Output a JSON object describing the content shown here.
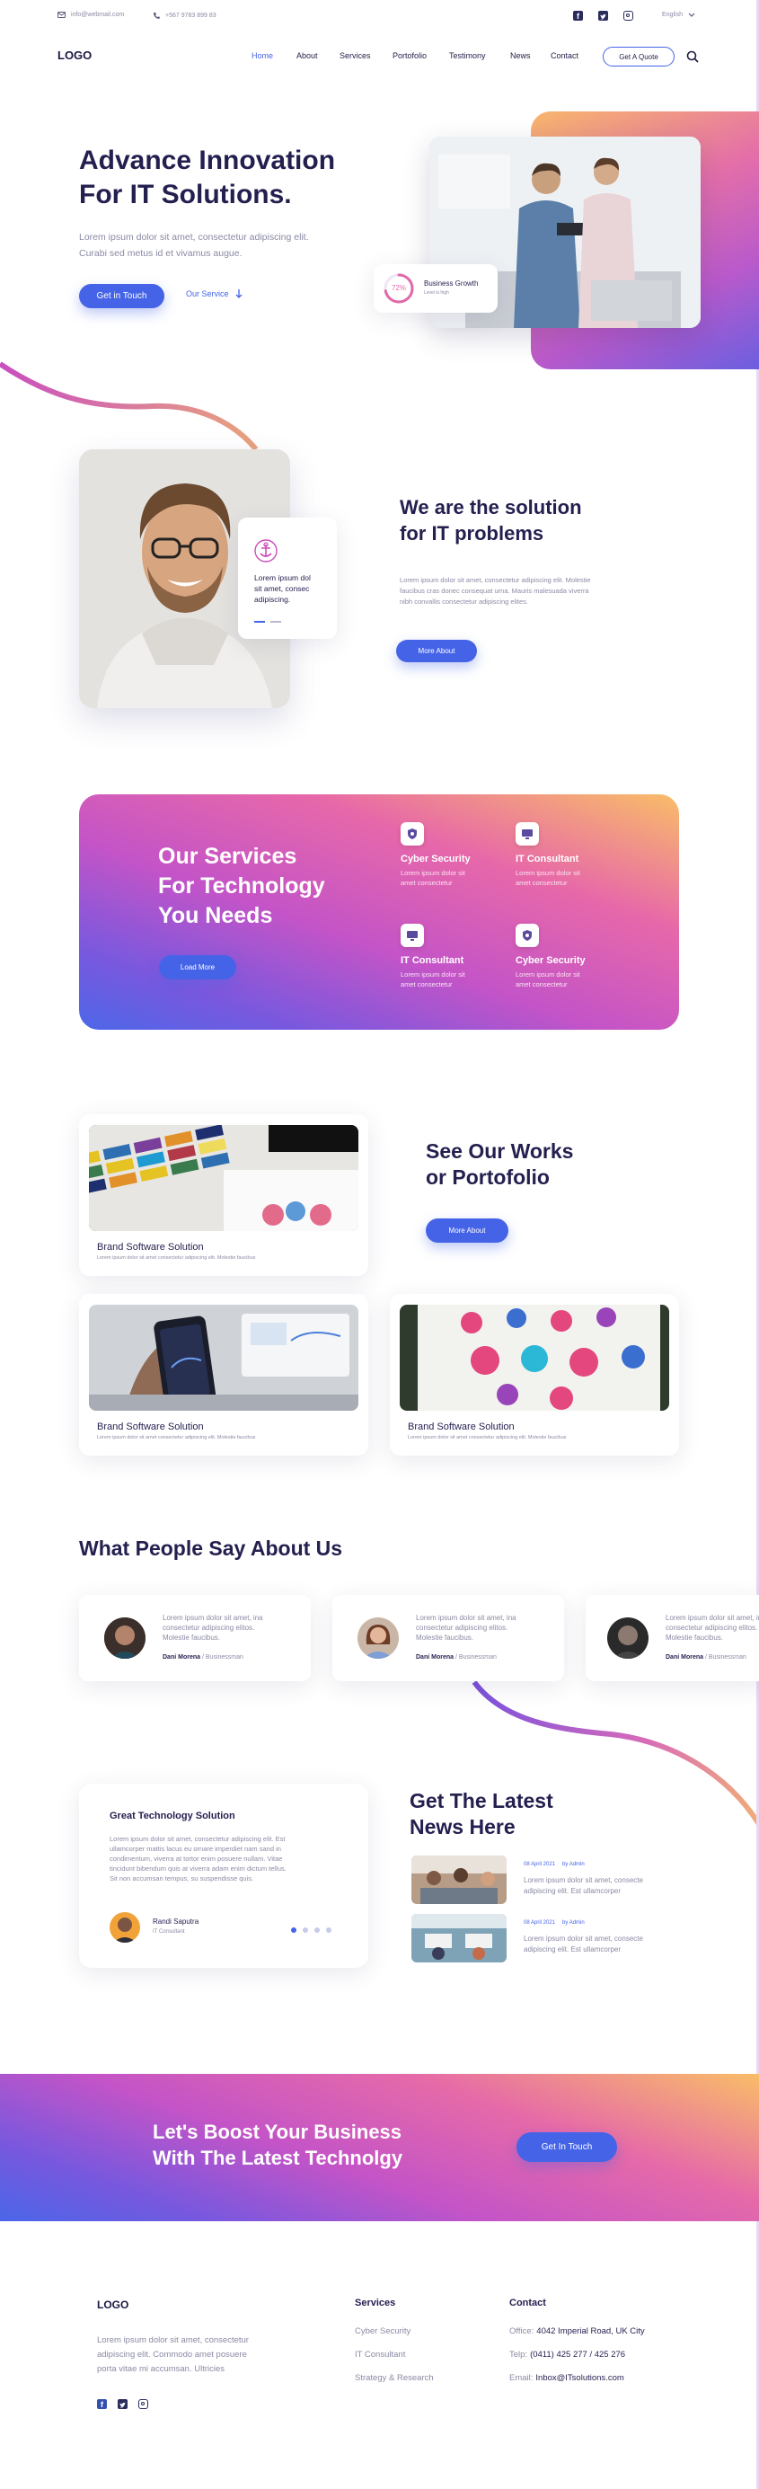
{
  "topbar": {
    "email": "info@webmail.com",
    "phone": "+567 9783 899 83",
    "language": "English"
  },
  "nav": {
    "logo": "LOGO",
    "items": [
      "Home",
      "About",
      "Services",
      "Portofolio",
      "Testimony",
      "News",
      "Contact"
    ],
    "quote_button": "Get A Quote"
  },
  "hero": {
    "title_line1": "Advance Innovation",
    "title_line2": "For IT Solutions.",
    "desc_line1": "Lorem ipsum dolor sit amet, consectetur adipiscing elit.",
    "desc_line2": "Curabi sed metus id et vivamus augue.",
    "primary_button": "Get in Touch",
    "secondary_button": "Our Service",
    "growth_percent": "72%",
    "growth_label": "Business Growth",
    "growth_sub": "Level is high",
    "growth_value": 0.72
  },
  "about": {
    "card_text_line1": "Lorem ipsum dol",
    "card_text_line2": "sit amet, consec",
    "card_text_line3": "adipiscing.",
    "title_line1": "We are the solution",
    "title_line2": "for IT problems",
    "desc_line1": "Lorem ipsum dolor sit amet, consectetur adipiscing elit. Molestie",
    "desc_line2": "faucibus cras donec consequat urna. Mauris malesuada viverra",
    "desc_line3": "nibh convallis consectetur adipiscing elites.",
    "button": "More About"
  },
  "services": {
    "title_line1": "Our Services",
    "title_line2": "For Technology",
    "title_line3": "You Needs",
    "button": "Load More",
    "items": [
      {
        "title": "Cyber Security",
        "line1": "Lorem ipsum dolor sit",
        "line2": "amet consectetur",
        "icon": "shield-icon"
      },
      {
        "title": "IT Consultant",
        "line1": "Lorem ipsum dolor sit",
        "line2": "amet consectetur",
        "icon": "monitor-icon"
      },
      {
        "title": "IT Consultant",
        "line1": "Lorem ipsum dolor sit",
        "line2": "amet consectetur",
        "icon": "monitor-icon"
      },
      {
        "title": "Cyber Security",
        "line1": "Lorem ipsum dolor sit",
        "line2": "amet consectetur",
        "icon": "shield-icon"
      }
    ]
  },
  "works": {
    "title_line1": "See Our Works",
    "title_line2": "or Portofolio",
    "button": "More About",
    "items": [
      {
        "title": "Brand Software Solution",
        "desc": "Lorem ipsum dolor sit amet consectetur adipiscing elit. Molestie faucibus"
      },
      {
        "title": "Brand Software Solution",
        "desc": "Lorem ipsum dolor sit amet consectetur adipiscing elit. Molestie faucibus"
      },
      {
        "title": "Brand Software Solution",
        "desc": "Lorem ipsum dolor sit amet consectetur adipiscing elit. Molestie faucibus"
      }
    ]
  },
  "testimonials": {
    "title": "What People Say About Us",
    "items": [
      {
        "line1": "Lorem ipsum dolor sit amet, ina",
        "line2": "consectetur adipiscing elitos.",
        "line3": "Molestie faucibus.",
        "name": "Dani Morena",
        "role": "/ Businessman"
      },
      {
        "line1": "Lorem ipsum dolor sit amet, ina",
        "line2": "consectetur adipiscing elitos.",
        "line3": "Molestie faucibus.",
        "name": "Dani Morena",
        "role": "/ Businessman"
      },
      {
        "line1": "Lorem ipsum dolor sit amet, ina",
        "line2": "consectetur adipiscing elitos.",
        "line3": "Molestie faucibus.",
        "name": "Dani Morena",
        "role": "/ Businessman"
      }
    ]
  },
  "feature": {
    "title": "Great Technology Solution",
    "lines": [
      "Lorem ipsum dolor sit amet, consectetur adipiscing elit. Est",
      "ullamcorper mattis lacus eu ornare imperdiet nam sand in",
      "condimentum, viverra at tortor enim posuere nullam. Vitae",
      "tincidunt bibendum quis at viverra adam enim dictum tellus.",
      "Sit non accumsan tempus, su suspendisse quis."
    ],
    "author_name": "Randi Saputra",
    "author_role": "IT Consultant"
  },
  "news": {
    "title_line1": "Get The Latest",
    "title_line2": "News Here",
    "items": [
      {
        "date": "08 April 2021",
        "author": "by Admin",
        "line1": "Lorem ipsum dolor sit amet, consecte",
        "line2": "adipiscing elit. Est ullamcorper"
      },
      {
        "date": "08 April 2021",
        "author": "by Admin",
        "line1": "Lorem ipsum dolor sit amet, consecte",
        "line2": "adipiscing elit. Est ullamcorper"
      }
    ]
  },
  "cta": {
    "title_line1": "Let's Boost Your Business",
    "title_line2": "With The Latest Technolgy",
    "button": "Get In Touch"
  },
  "footer": {
    "logo": "LOGO",
    "desc_line1": "Lorem ipsum dolor sit amet, consectetur",
    "desc_line2": "adipiscing elit. Commodo amet posuere",
    "desc_line3": "porta vitae mi accumsan. Ultricies",
    "services_title": "Services",
    "services": [
      "Cyber Security",
      "IT Consultant",
      "Strategy & Research"
    ],
    "contact_title": "Contact",
    "office_label": "Office:",
    "office_value": "4042 Imperial Road, UK City",
    "telp_label": "Telp:",
    "telp_value": "(0411) 425 277 / 425 276",
    "email_label": "Email:",
    "email_value": "Inbox@ITsolutions.com"
  },
  "colors": {
    "accent": "#4563e6",
    "heading": "#231f4f",
    "pink": "#d05bc2",
    "orange": "#f6b267"
  }
}
